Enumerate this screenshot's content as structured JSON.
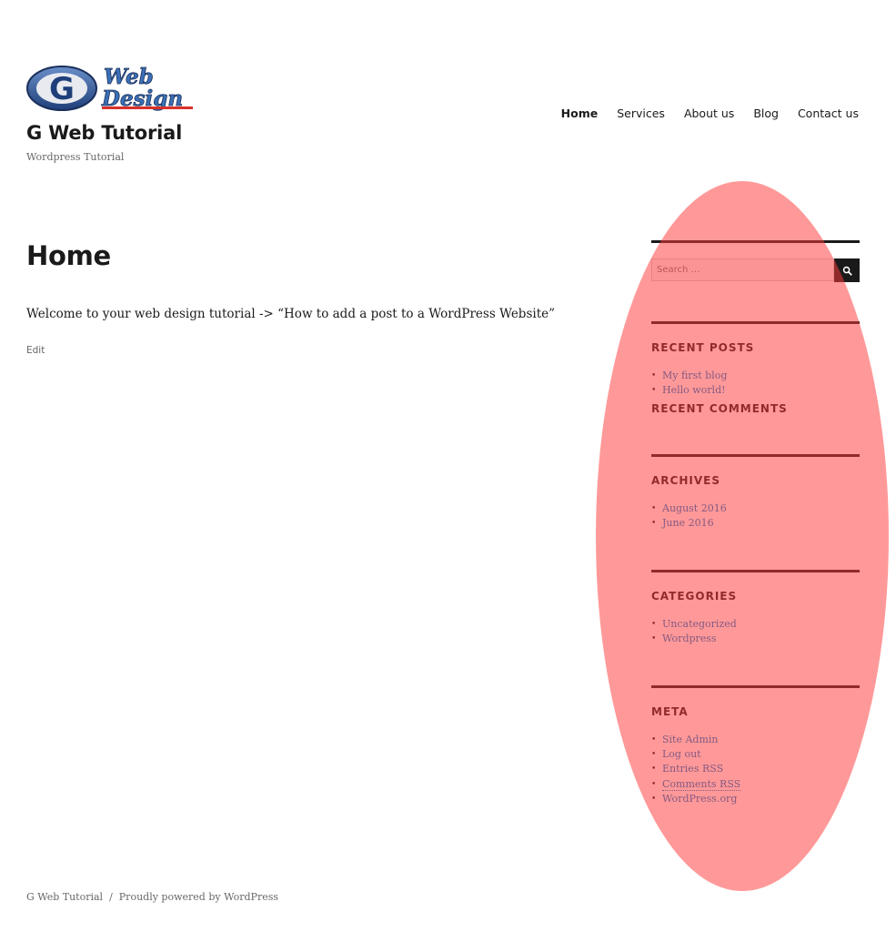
{
  "site": {
    "logo_text_top": "Web",
    "logo_text_bottom": "Design",
    "logo_letter": "G",
    "title": "G Web Tutorial",
    "description": "Wordpress Tutorial"
  },
  "nav": {
    "items": [
      {
        "label": "Home",
        "current": true
      },
      {
        "label": "Services",
        "current": false
      },
      {
        "label": "About us",
        "current": false
      },
      {
        "label": "Blog",
        "current": false
      },
      {
        "label": "Contact us",
        "current": false
      }
    ]
  },
  "main": {
    "page_title": "Home",
    "content": "Welcome to your web design tutorial -> “How to add a post to a WordPress Website”",
    "edit_label": "Edit"
  },
  "sidebar": {
    "search": {
      "placeholder": "Search …",
      "button_icon": "search-icon"
    },
    "recent_posts": {
      "title": "RECENT POSTS",
      "items": [
        "My first blog",
        "Hello world!"
      ]
    },
    "recent_comments": {
      "title": "RECENT COMMENTS"
    },
    "archives": {
      "title": "ARCHIVES",
      "items": [
        "August 2016",
        "June 2016"
      ]
    },
    "categories": {
      "title": "CATEGORIES",
      "items": [
        "Uncategorized",
        "Wordpress"
      ]
    },
    "meta": {
      "title": "META",
      "items": [
        "Site Admin",
        "Log out",
        "Entries RSS",
        "Comments RSS",
        "WordPress.org"
      ]
    }
  },
  "footer": {
    "site_name": "G Web Tutorial",
    "separator": "/",
    "powered_by": "Proudly powered by WordPress"
  },
  "colors": {
    "link": "#007acc",
    "text": "#1a1a1a",
    "muted": "#686868",
    "highlight": "#ff3c3c"
  }
}
